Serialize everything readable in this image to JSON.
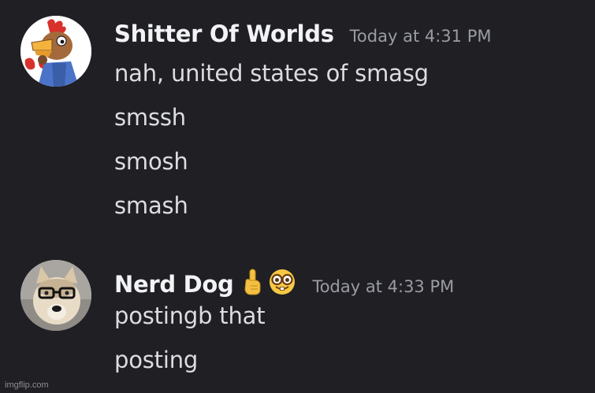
{
  "messages": [
    {
      "username": "Shitter Of Worlds",
      "timestamp": "Today at 4:31 PM",
      "lines": [
        "nah, united states of smasg",
        "smssh",
        "smosh",
        "smash"
      ],
      "avatar_icon": "cartoon-rooster-avatar"
    },
    {
      "username": "Nerd Dog",
      "timestamp": "Today at 4:33 PM",
      "emojis": [
        "index-pointing-up-emoji",
        "nerd-face-emoji"
      ],
      "lines": [
        "postingb that",
        "posting"
      ],
      "avatar_icon": "dog-with-glasses-avatar"
    }
  ],
  "watermark": "imgflip.com",
  "colors": {
    "background": "#1f1f24",
    "username": "#f2f3f5",
    "message_text": "#dcdde1",
    "timestamp": "#9a9ca4"
  }
}
